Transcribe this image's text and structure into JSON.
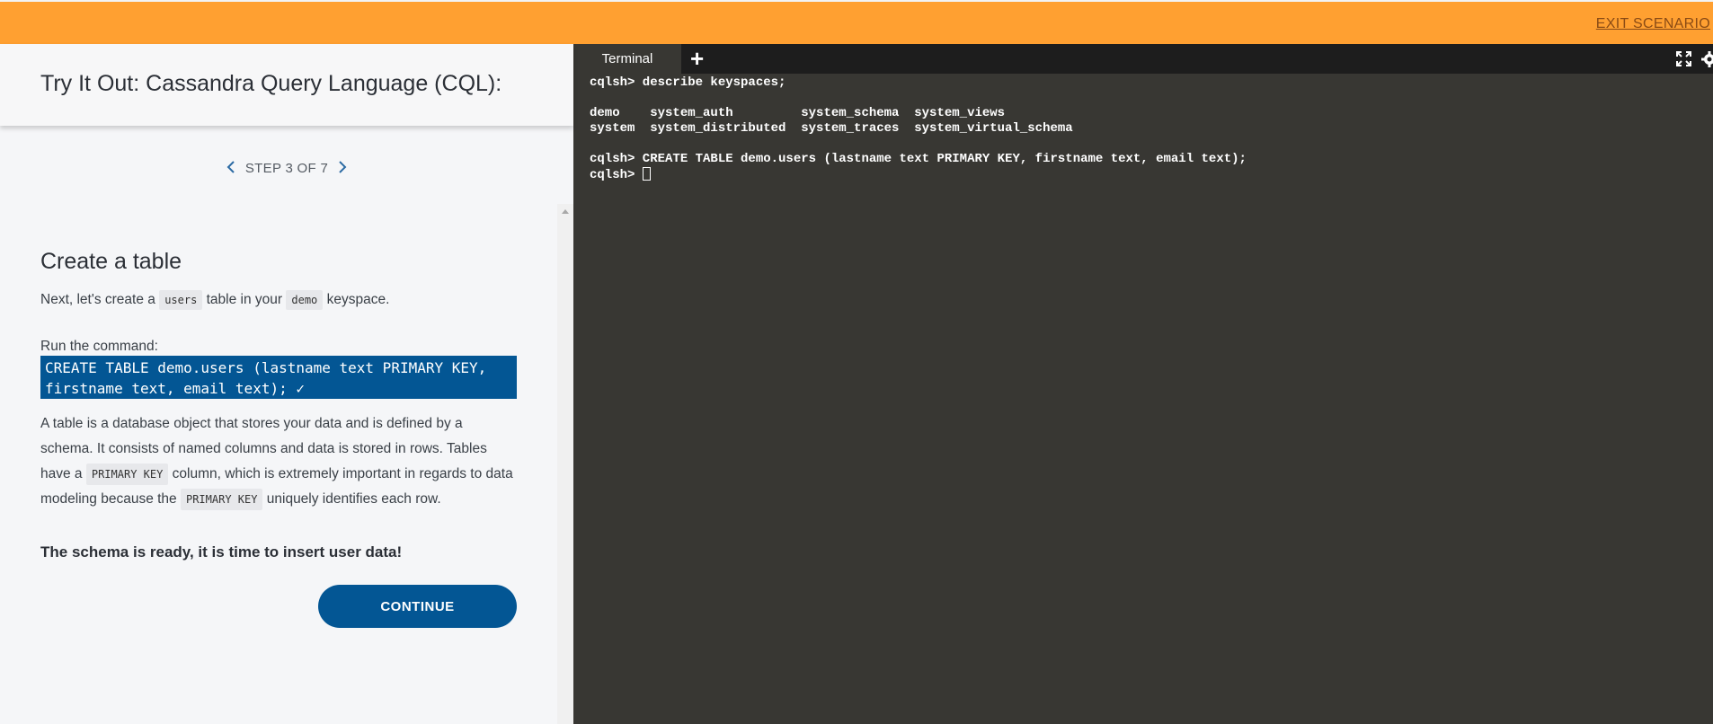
{
  "topbar": {
    "exit_label": "EXIT SCENARIO"
  },
  "scenario": {
    "title": "Try It Out: Cassandra Query Language (CQL):"
  },
  "stepper": {
    "prev_icon": "chevron-left-icon",
    "next_icon": "chevron-right-icon",
    "label": "STEP 3 OF 7"
  },
  "step": {
    "title": "Create a table",
    "intro_pre": "Next, let's create a ",
    "intro_code1": "users",
    "intro_mid": " table in your ",
    "intro_code2": "demo",
    "intro_post": " keyspace.",
    "run_label": "Run the command:",
    "command": "CREATE TABLE demo.users (lastname text PRIMARY KEY, firstname text, email text);",
    "command_check": "✓",
    "desc_1": "A table is a database object that stores your data and is defined by a schema. It consists of named columns and data is stored in rows. Tables have a ",
    "desc_code1": "PRIMARY KEY",
    "desc_2": " column, which is extremely important in regards to data modeling because the ",
    "desc_code2": "PRIMARY KEY",
    "desc_3": " uniquely identifies each row.",
    "callout": "The schema is ready, it is time to insert user data!",
    "continue_label": "CONTINUE"
  },
  "terminal": {
    "tab_label": "Terminal",
    "add_icon": "plus-icon",
    "expand_icon": "expand-icon",
    "settings_icon": "gear-icon",
    "lines": [
      "cqlsh> describe keyspaces;",
      "",
      "demo    system_auth         system_schema  system_views",
      "system  system_distributed  system_traces  system_virtual_schema",
      "",
      "cqlsh> CREATE TABLE demo.users (lastname text PRIMARY KEY, firstname text, email text);"
    ],
    "prompt": "cqlsh> "
  },
  "colors": {
    "topbar": "#ffa031",
    "accent": "#035694",
    "terminal_bg": "#383733",
    "left_bg": "#f5f6f8"
  }
}
